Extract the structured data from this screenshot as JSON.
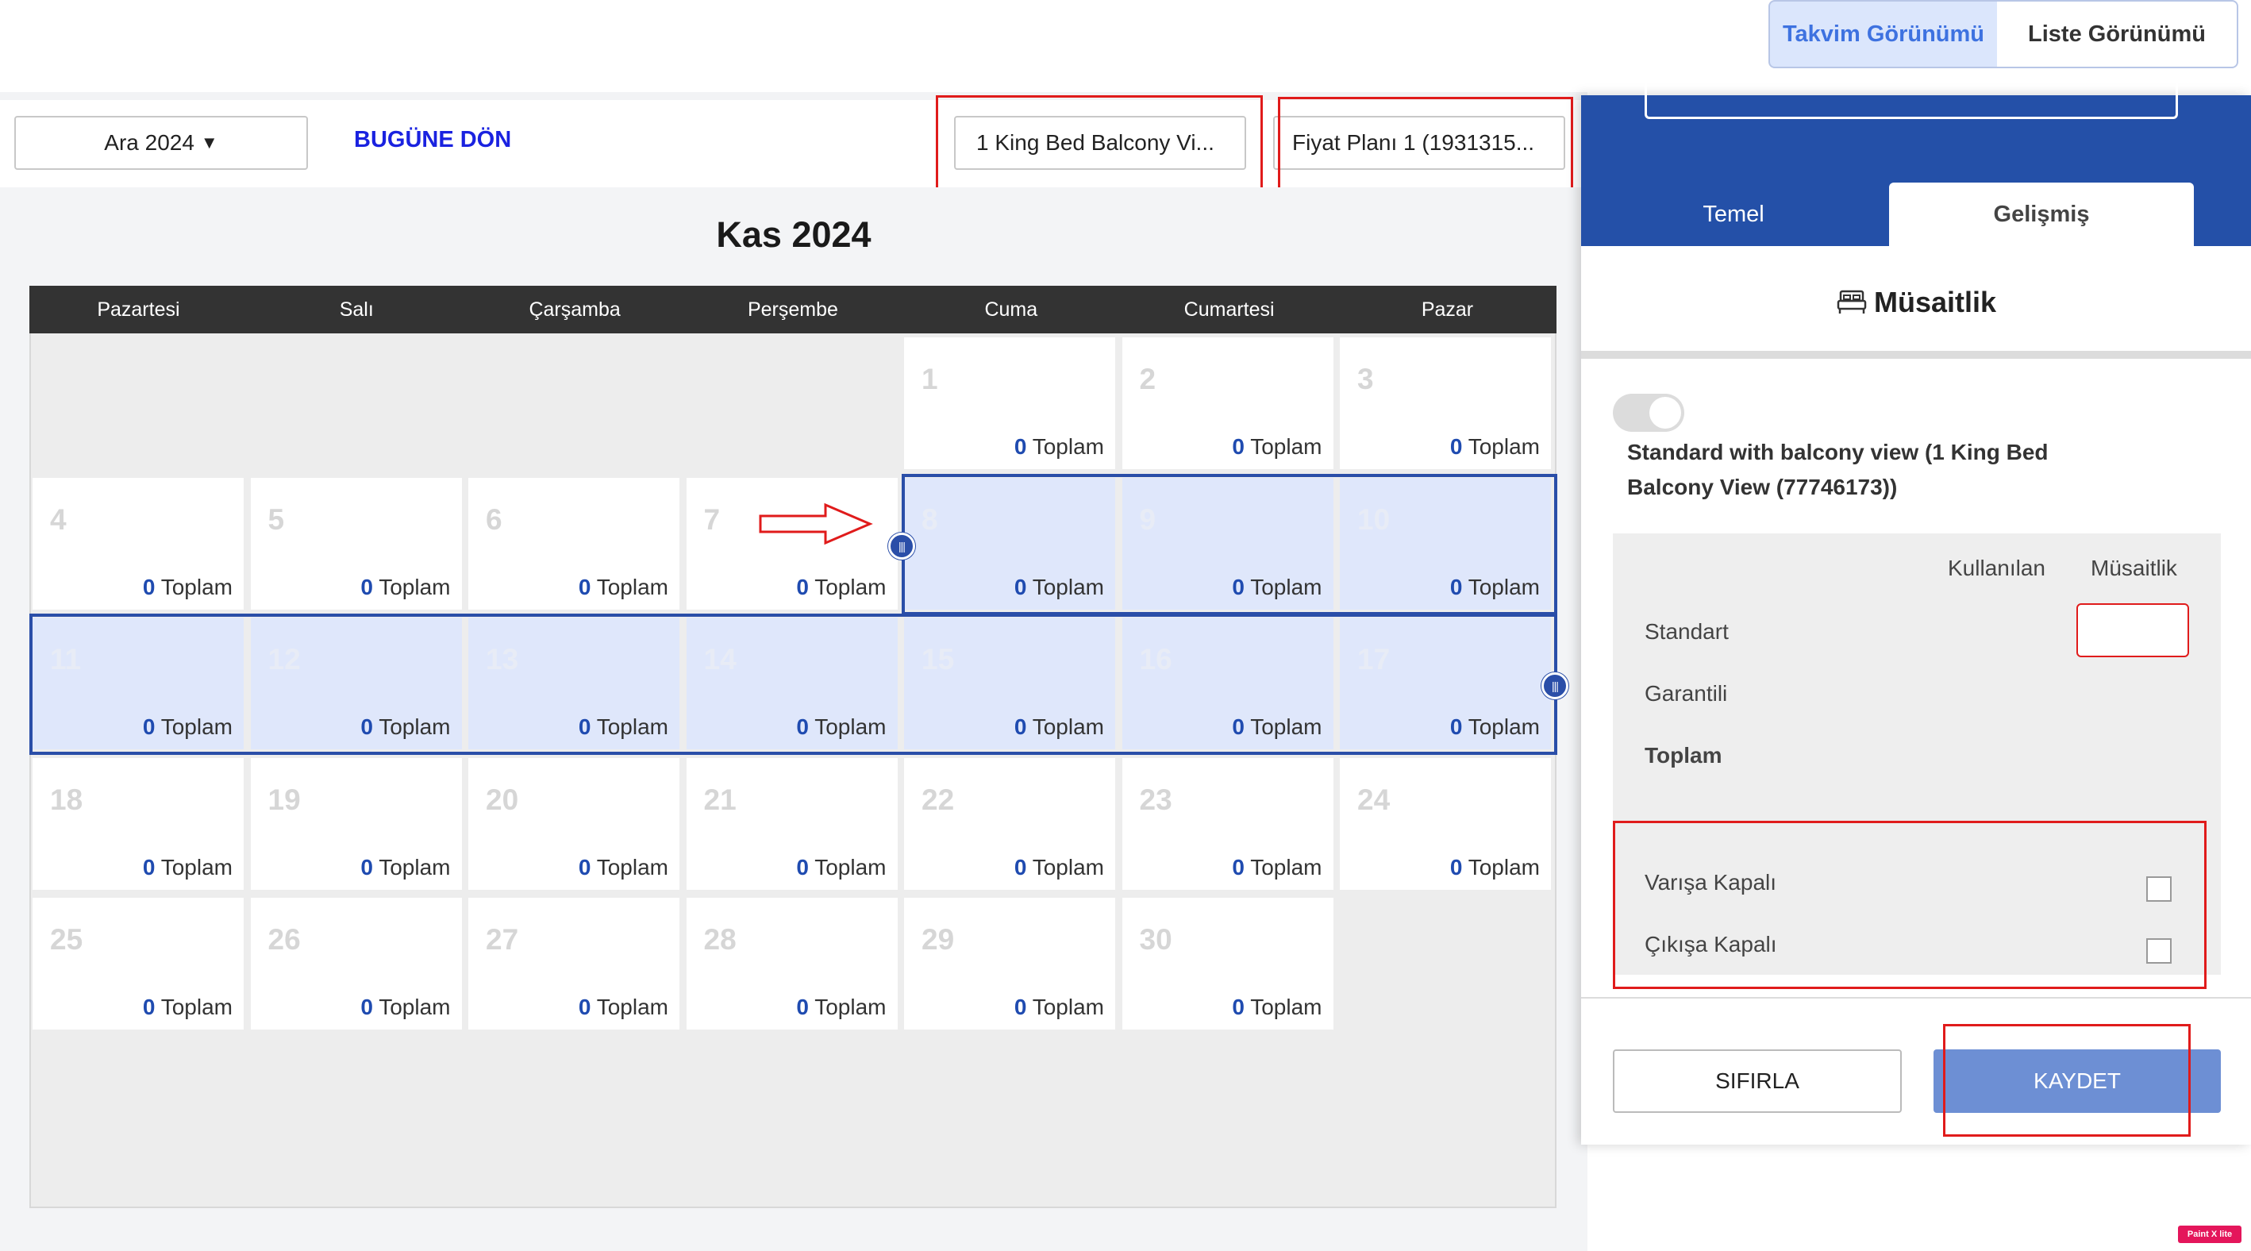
{
  "header": {
    "calendar_view_label": "Takvim Görünümü",
    "list_view_label": "Liste Görünümü"
  },
  "toolbar": {
    "month_label": "Ara 2024",
    "today_label": "BUGÜNE DÖN",
    "room_select_value": "1 King Bed Balcony Vi...",
    "rate_select_value": "Fiyat Planı 1 (1931315..."
  },
  "calendar": {
    "title": "Kas 2024",
    "weekdays": [
      "Pazartesi",
      "Salı",
      "Çarşamba",
      "Perşembe",
      "Cuma",
      "Cumartesi",
      "Pazar"
    ],
    "total_value": "0",
    "total_label": "Toplam",
    "days": [
      "1",
      "2",
      "3",
      "4",
      "5",
      "6",
      "7",
      "8",
      "9",
      "10",
      "11",
      "12",
      "13",
      "14",
      "15",
      "16",
      "17",
      "18",
      "19",
      "20",
      "21",
      "22",
      "23",
      "24",
      "25",
      "26",
      "27",
      "28",
      "29",
      "30"
    ]
  },
  "panel": {
    "tab_basic": "Temel",
    "tab_advanced": "Gelişmiş",
    "heading": "Müsaitlik",
    "room_name": "Standard with balcony view (1 King Bed Balcony View (77746173))",
    "col_used": "Kullanılan",
    "col_available": "Müsaitlik",
    "row_standard": "Standart",
    "row_guaranteed": "Garantili",
    "row_total": "Toplam",
    "closed_arrival": "Varışa Kapalı",
    "closed_departure": "Çıkışa Kapalı",
    "reset_label": "SIFIRLA",
    "save_label": "KAYDET"
  },
  "watermark": "Paint X lite",
  "colors": {
    "accent": "#2450a8",
    "selection": "#dfe7fb",
    "annotation": "#e01b1b",
    "save_button": "#6d8fd4"
  },
  "icons": [
    "dropdown-caret-icon",
    "bed-icon",
    "drag-handle-icon",
    "arrow-annotation-icon"
  ]
}
